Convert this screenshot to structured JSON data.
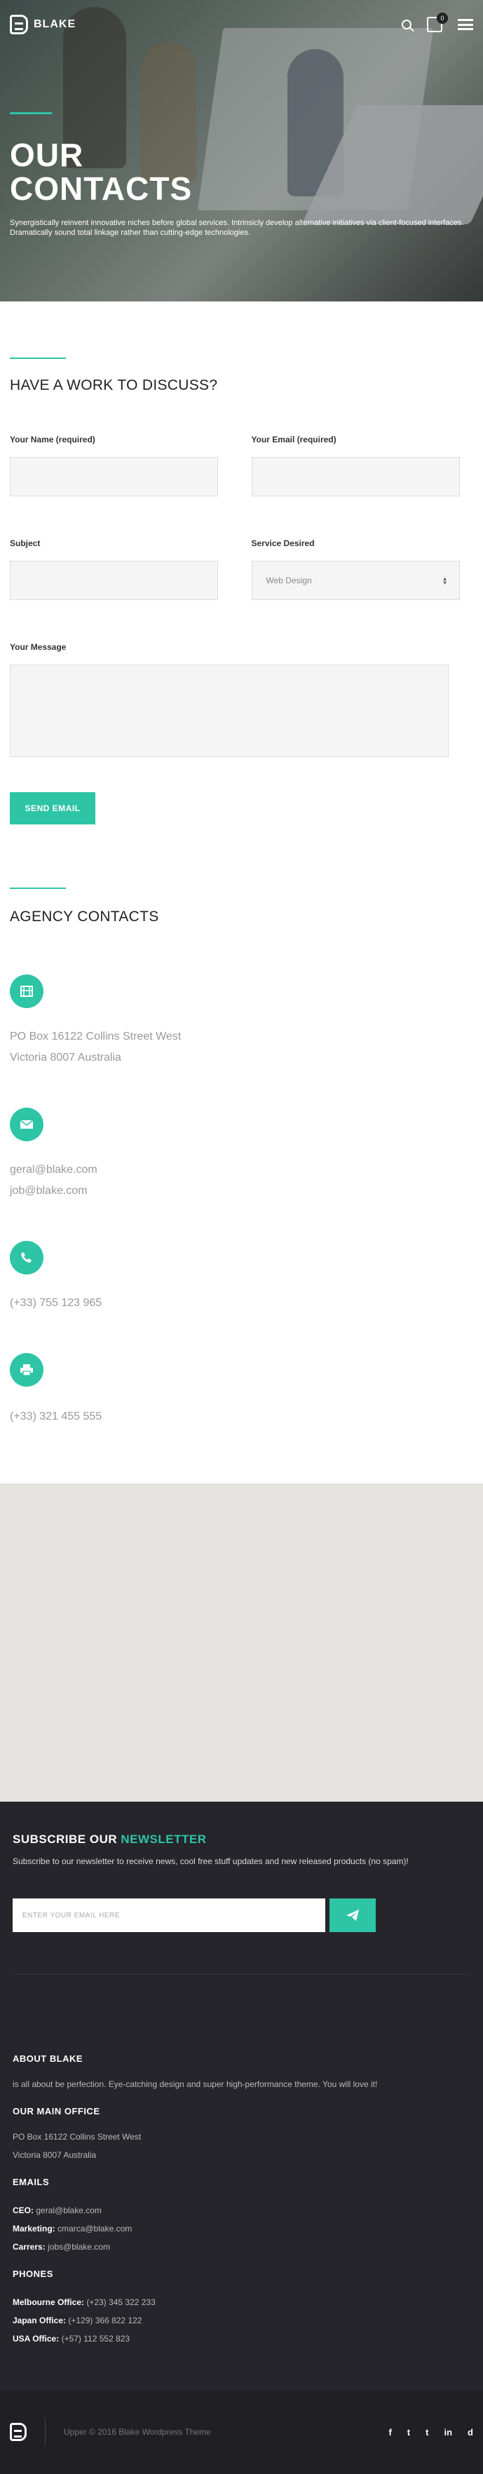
{
  "header": {
    "logo_text": "BLAKE",
    "cart_count": "0",
    "icons": [
      "search-icon",
      "bag-icon",
      "menu-icon"
    ]
  },
  "hero": {
    "title": "OUR CONTACTS",
    "subtitle": "Synergistically reinvent innovative niches before global services. Intrinsicly develop alternative initiatives via client-focused interfaces. Dramatically sound total linkage rather than cutting-edge technologies."
  },
  "form": {
    "title": "HAVE A WORK TO DISCUSS?",
    "name_label": "Your Name (required)",
    "email_label": "Your Email (required)",
    "subject_label": "Subject",
    "service_label": "Service Desired",
    "service_selected": "Web Design",
    "message_label": "Your Message",
    "submit_label": "SEND EMAIL"
  },
  "agency": {
    "title": "AGENCY CONTACTS",
    "address_line1": "PO Box 16122 Collins Street West",
    "address_line2": "Victoria 8007 Australia",
    "email1": "geral@blake.com",
    "email2": "job@blake.com",
    "phone": "(+33) 755 123 965",
    "fax": "(+33) 321 455 555"
  },
  "newsletter": {
    "title_prefix": "SUBSCRIBE OUR",
    "title_highlight": "NEWSLETTER",
    "description": "Subscribe to our newsletter to receive news, cool free stuff updates and new released products (no spam)!",
    "placeholder": "ENTER YOUR EMAIL HERE"
  },
  "footer": {
    "about_title": "ABOUT BLAKE",
    "about_text": "is all about be perfection. Eye-catching design and super high-performance theme. You will love it!",
    "office_title": "OUR MAIN OFFICE",
    "office_line1": "PO Box 16122 Collins Street West",
    "office_line2": "Victoria 8007 Australia",
    "emails_title": "EMAILS",
    "emails": [
      {
        "label": "CEO:",
        "value": "geral@blake.com"
      },
      {
        "label": "Marketing:",
        "value": "cmarca@blake.com"
      },
      {
        "label": "Carrers:",
        "value": "jobs@blake.com"
      }
    ],
    "phones_title": "PHONES",
    "phones": [
      {
        "label": "Melbourne Office:",
        "value": "(+23) 345 322 233"
      },
      {
        "label": "Japan Office:",
        "value": "(+129) 366 822 122"
      },
      {
        "label": "USA Office:",
        "value": "(+57) 112 552 823"
      }
    ],
    "copyright": "Upper © 2016 Blake Wordpress Theme",
    "socials": [
      "f",
      "t",
      "t",
      "in",
      "d"
    ]
  },
  "colors": {
    "accent": "#2ec4a6",
    "dark_bg": "#25252b",
    "map_bg": "#e5e3df"
  }
}
